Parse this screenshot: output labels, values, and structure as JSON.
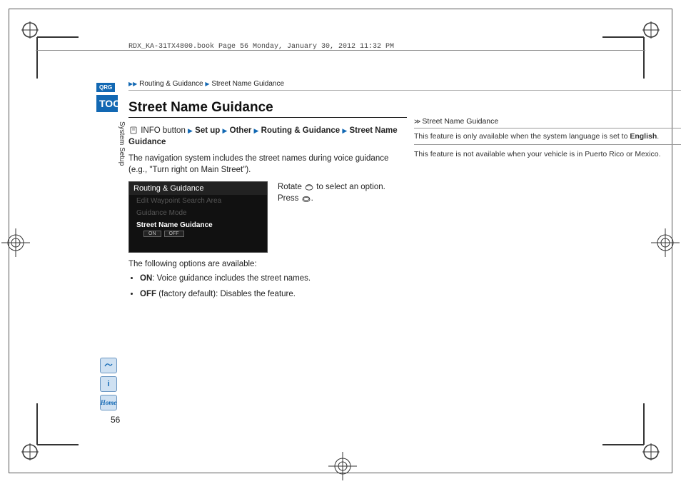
{
  "header": {
    "filestamp": "RDX_KA-31TX4800.book  Page 56  Monday, January 30, 2012  11:32 PM"
  },
  "breadcrumb": {
    "level1": "Routing & Guidance",
    "level2": "Street Name Guidance"
  },
  "sidebar": {
    "qrg": "QRG",
    "toc": "TOC",
    "section_label": "System Setup"
  },
  "main": {
    "title": "Street Name Guidance",
    "path_prefix": "INFO button",
    "path_items": [
      "Set up",
      "Other",
      "Routing & Guidance",
      "Street Name Guidance"
    ],
    "intro": "The navigation system includes the street names during voice guidance (e.g., \"Turn right on Main Street\").",
    "instruction_a": "Rotate ",
    "instruction_b": " to select an option. Press ",
    "instruction_c": ".",
    "nav_screenshot": {
      "header": "Routing & Guidance",
      "item1": "Edit Waypoint Search Area",
      "item2": "Guidance Mode",
      "item3": "Street Name Guidance",
      "on": "ON",
      "off": "OFF"
    },
    "following": "The following options are available:",
    "bullets": [
      {
        "label": "ON",
        "text": ": Voice guidance includes the street names."
      },
      {
        "label": "OFF",
        "text": " (factory default): Disables the feature."
      }
    ]
  },
  "side": {
    "title": "Street Name Guidance",
    "box_a": "This feature is only available when the system language is set to ",
    "box_b_bold": "English",
    "box_c": ".",
    "note2": "This feature is not available when your vehicle is in Puerto Rico or Mexico."
  },
  "bottom_icons": {
    "voice_label": "voice",
    "info_label": "info",
    "home_label": "Home"
  },
  "page_number": "56"
}
